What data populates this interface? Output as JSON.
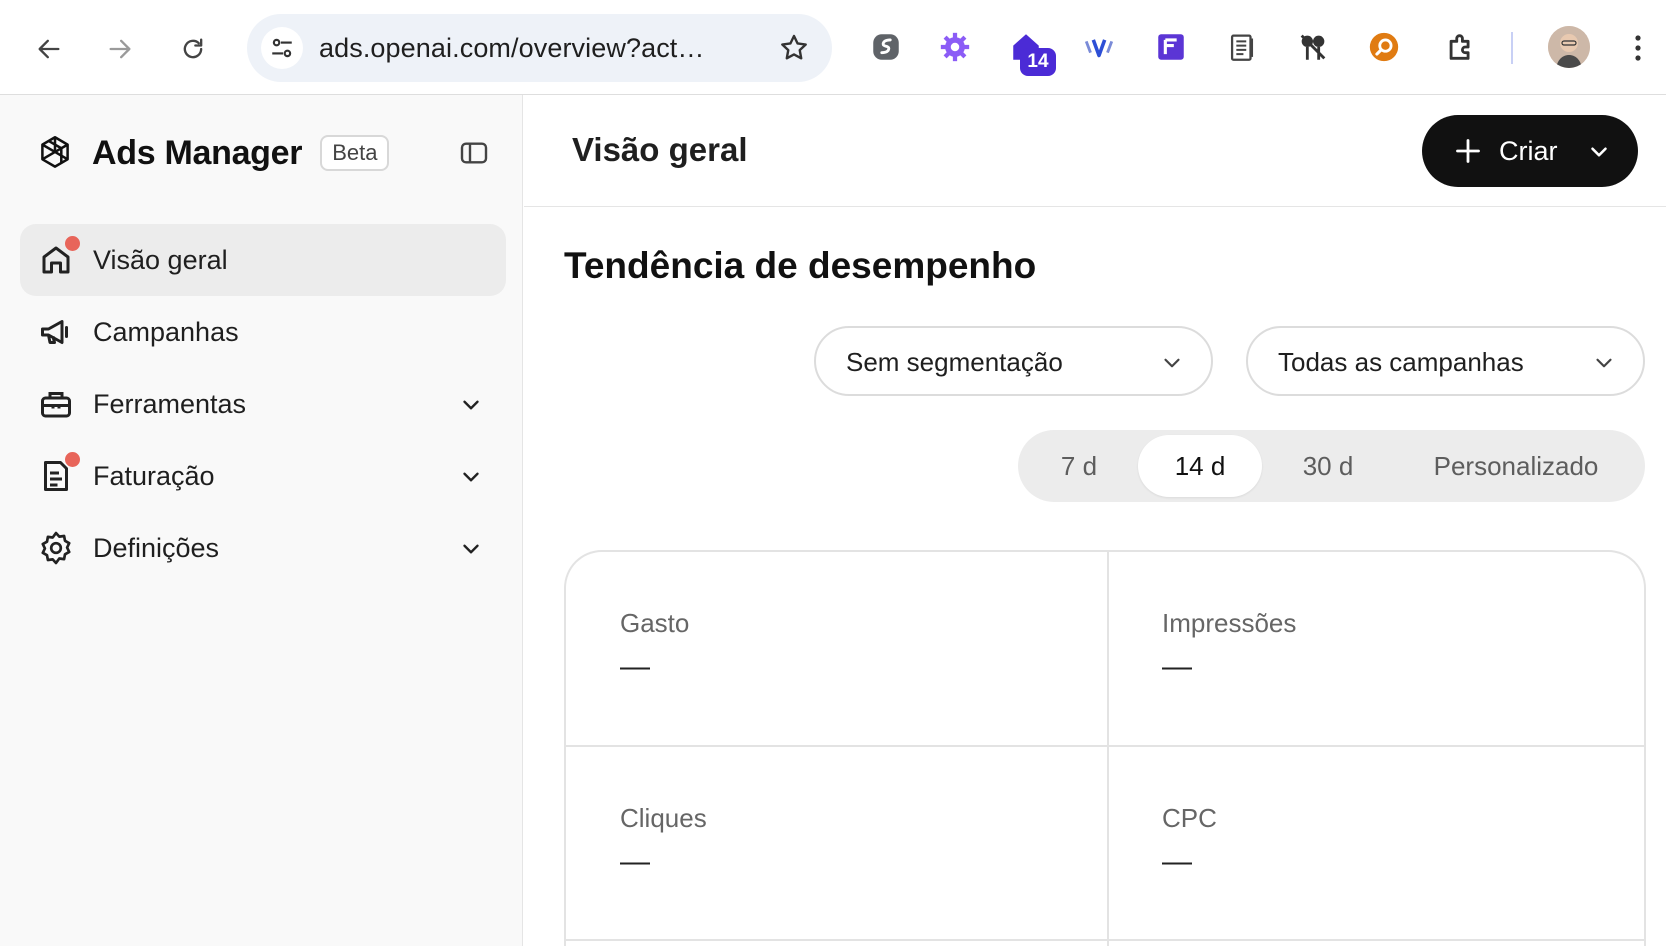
{
  "browser": {
    "url": "ads.openai.com/overview?act…",
    "extension_icons": [
      "surfshark-icon",
      "settings-puzzle-icon",
      "house-badge-icon",
      "vectorize-icon",
      "forms-icon",
      "notes-icon",
      "keys-icon",
      "search-circle-icon",
      "extensions-puzzle-icon"
    ],
    "house_badge_count": "14",
    "accent_colors": {
      "forms": "#5b35d5",
      "badge": "#4b2bd6",
      "search_circle": "#e07b12"
    }
  },
  "sidebar": {
    "brand": "Ads Manager",
    "beta": "Beta",
    "items": [
      {
        "label": "Visão geral",
        "icon": "home-icon",
        "active": true,
        "dot": true
      },
      {
        "label": "Campanhas",
        "icon": "megaphone-icon",
        "active": false,
        "dot": false
      },
      {
        "label": "Ferramentas",
        "icon": "toolbox-icon",
        "active": false,
        "dot": false,
        "expandable": true
      },
      {
        "label": "Faturação",
        "icon": "invoice-icon",
        "active": false,
        "dot": true,
        "expandable": true
      },
      {
        "label": "Definições",
        "icon": "gear-icon",
        "active": false,
        "dot": false,
        "expandable": true
      }
    ]
  },
  "header": {
    "title": "Visão geral",
    "create_label": "Criar"
  },
  "performance": {
    "title": "Tendência de desempenho",
    "segmentation": "Sem segmentação",
    "campaigns": "Todas as campanhas",
    "ranges": [
      "7 d",
      "14 d",
      "30 d",
      "Personalizado"
    ],
    "selected_range": "14 d",
    "metrics": [
      {
        "label": "Gasto",
        "value": "—"
      },
      {
        "label": "Impressões",
        "value": "—"
      },
      {
        "label": "Cliques",
        "value": "—"
      },
      {
        "label": "CPC",
        "value": "—"
      }
    ]
  }
}
